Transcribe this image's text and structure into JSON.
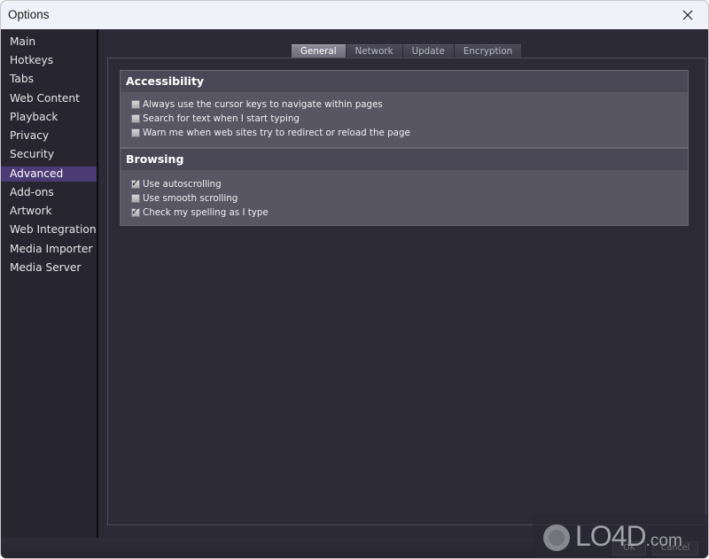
{
  "window": {
    "title": "Options"
  },
  "sidebar": {
    "items": [
      {
        "label": "Main",
        "active": false
      },
      {
        "label": "Hotkeys",
        "active": false
      },
      {
        "label": "Tabs",
        "active": false
      },
      {
        "label": "Web Content",
        "active": false
      },
      {
        "label": "Playback",
        "active": false
      },
      {
        "label": "Privacy",
        "active": false
      },
      {
        "label": "Security",
        "active": false
      },
      {
        "label": "Advanced",
        "active": true
      },
      {
        "label": "Add-ons",
        "active": false
      },
      {
        "label": "Artwork",
        "active": false
      },
      {
        "label": "Web Integration",
        "active": false
      },
      {
        "label": "Media Importer",
        "active": false
      },
      {
        "label": "Media Server",
        "active": false
      }
    ]
  },
  "tabs": [
    {
      "label": "General",
      "active": true
    },
    {
      "label": "Network",
      "active": false
    },
    {
      "label": "Update",
      "active": false
    },
    {
      "label": "Encryption",
      "active": false
    }
  ],
  "groups": [
    {
      "title": "Accessibility",
      "options": [
        {
          "label": "Always use the cursor keys to navigate within pages",
          "checked": false
        },
        {
          "label": "Search for text when I start typing",
          "checked": false
        },
        {
          "label": "Warn me when web sites try to redirect or reload the page",
          "checked": false
        }
      ]
    },
    {
      "title": "Browsing",
      "options": [
        {
          "label": "Use autoscrolling",
          "checked": true
        },
        {
          "label": "Use smooth scrolling",
          "checked": false
        },
        {
          "label": "Check my spelling as I type",
          "checked": true
        }
      ]
    }
  ],
  "footer": {
    "ok_label": "OK",
    "cancel_label": "Cancel"
  },
  "watermark": {
    "text": "LO4D",
    "suffix": ".com"
  },
  "colors": {
    "accent": "#4a3b74",
    "titlebar": "#eff2f8",
    "background": "#2c2a37"
  }
}
